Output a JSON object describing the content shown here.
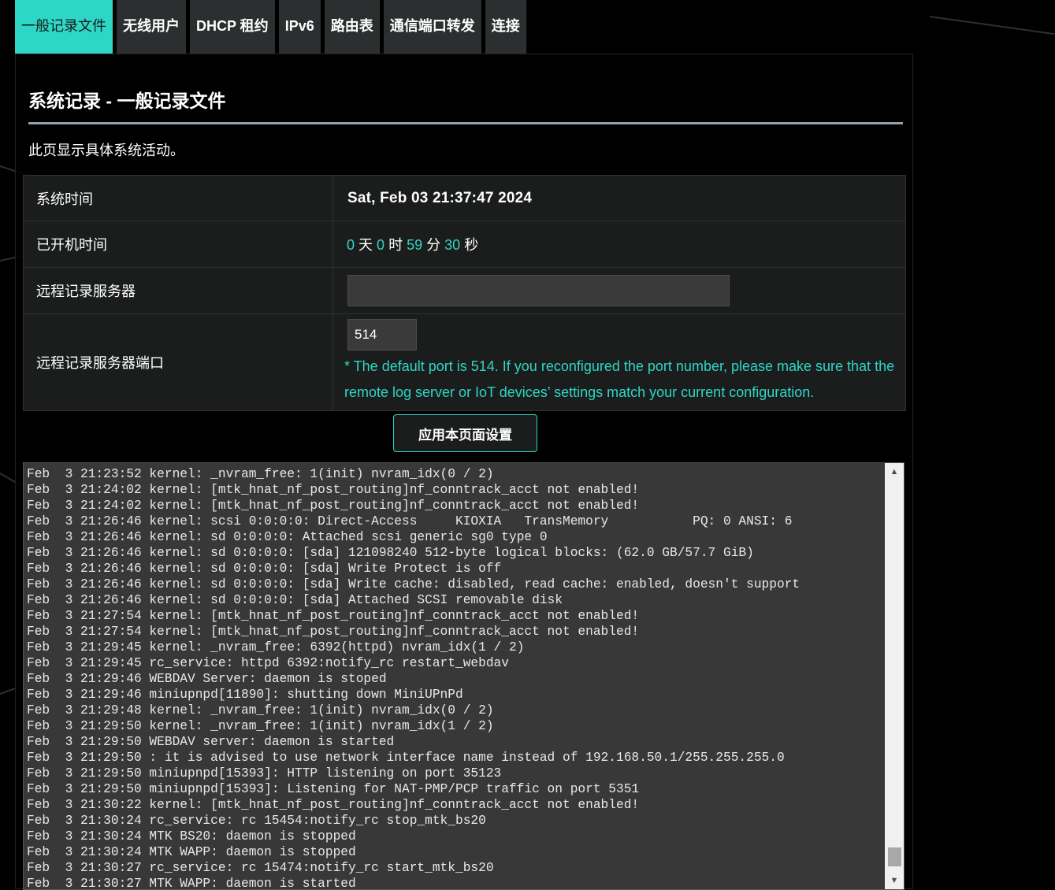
{
  "tabs": [
    {
      "label": "一般记录文件",
      "active": true
    },
    {
      "label": "无线用户"
    },
    {
      "label": "DHCP 租约"
    },
    {
      "label": "IPv6"
    },
    {
      "label": "路由表"
    },
    {
      "label": "通信端口转发"
    },
    {
      "label": "连接"
    }
  ],
  "page": {
    "title": "系统记录 - 一般记录文件",
    "description": "此页显示具体系统活动。"
  },
  "settings": {
    "system_time_label": "系统时间",
    "system_time_value": "Sat, Feb 03 21:37:47 2024",
    "uptime_label": "已开机时间",
    "uptime": {
      "days": "0",
      "days_unit": "天",
      "hours": "0",
      "hours_unit": "时",
      "minutes": "59",
      "minutes_unit": "分",
      "seconds": "30",
      "seconds_unit": "秒"
    },
    "remote_server_label": "远程记录服务器",
    "remote_server_value": "",
    "remote_port_label": "远程记录服务器端口",
    "remote_port_value": "514",
    "remote_port_hint": "* The default port is 514. If you reconfigured the port number, please make sure that the remote log server or IoT devices’ settings match your current configuration."
  },
  "apply_button": "应用本页面设置",
  "log_lines": [
    "Feb  3 21:23:52 kernel: _nvram_free: 1(init) nvram_idx(0 / 2)",
    "Feb  3 21:24:02 kernel: [mtk_hnat_nf_post_routing]nf_conntrack_acct not enabled!",
    "Feb  3 21:24:02 kernel: [mtk_hnat_nf_post_routing]nf_conntrack_acct not enabled!",
    "Feb  3 21:26:46 kernel: scsi 0:0:0:0: Direct-Access     KIOXIA   TransMemory           PQ: 0 ANSI: 6",
    "Feb  3 21:26:46 kernel: sd 0:0:0:0: Attached scsi generic sg0 type 0",
    "Feb  3 21:26:46 kernel: sd 0:0:0:0: [sda] 121098240 512-byte logical blocks: (62.0 GB/57.7 GiB)",
    "Feb  3 21:26:46 kernel: sd 0:0:0:0: [sda] Write Protect is off",
    "Feb  3 21:26:46 kernel: sd 0:0:0:0: [sda] Write cache: disabled, read cache: enabled, doesn't support",
    "Feb  3 21:26:46 kernel: sd 0:0:0:0: [sda] Attached SCSI removable disk",
    "Feb  3 21:27:54 kernel: [mtk_hnat_nf_post_routing]nf_conntrack_acct not enabled!",
    "Feb  3 21:27:54 kernel: [mtk_hnat_nf_post_routing]nf_conntrack_acct not enabled!",
    "Feb  3 21:29:45 kernel: _nvram_free: 6392(httpd) nvram_idx(1 / 2)",
    "Feb  3 21:29:45 rc_service: httpd 6392:notify_rc restart_webdav",
    "Feb  3 21:29:46 WEBDAV Server: daemon is stoped",
    "Feb  3 21:29:46 miniupnpd[11890]: shutting down MiniUPnPd",
    "Feb  3 21:29:48 kernel: _nvram_free: 1(init) nvram_idx(0 / 2)",
    "Feb  3 21:29:50 kernel: _nvram_free: 1(init) nvram_idx(1 / 2)",
    "Feb  3 21:29:50 WEBDAV server: daemon is started",
    "Feb  3 21:29:50 : it is advised to use network interface name instead of 192.168.50.1/255.255.255.0",
    "Feb  3 21:29:50 miniupnpd[15393]: HTTP listening on port 35123",
    "Feb  3 21:29:50 miniupnpd[15393]: Listening for NAT-PMP/PCP traffic on port 5351",
    "Feb  3 21:30:22 kernel: [mtk_hnat_nf_post_routing]nf_conntrack_acct not enabled!",
    "Feb  3 21:30:24 rc_service: rc 15454:notify_rc stop_mtk_bs20",
    "Feb  3 21:30:24 MTK BS20: daemon is stopped",
    "Feb  3 21:30:24 MTK WAPP: daemon is stopped",
    "Feb  3 21:30:27 rc_service: rc 15474:notify_rc start_mtk_bs20",
    "Feb  3 21:30:27 MTK WAPP: daemon is started"
  ],
  "icons": {
    "scroll_up": "triangle-up-icon",
    "scroll_down": "triangle-down-icon"
  },
  "colors": {
    "accent": "#2dd7c6",
    "tab_bg": "#2b2f30",
    "log_bg": "#383838"
  }
}
